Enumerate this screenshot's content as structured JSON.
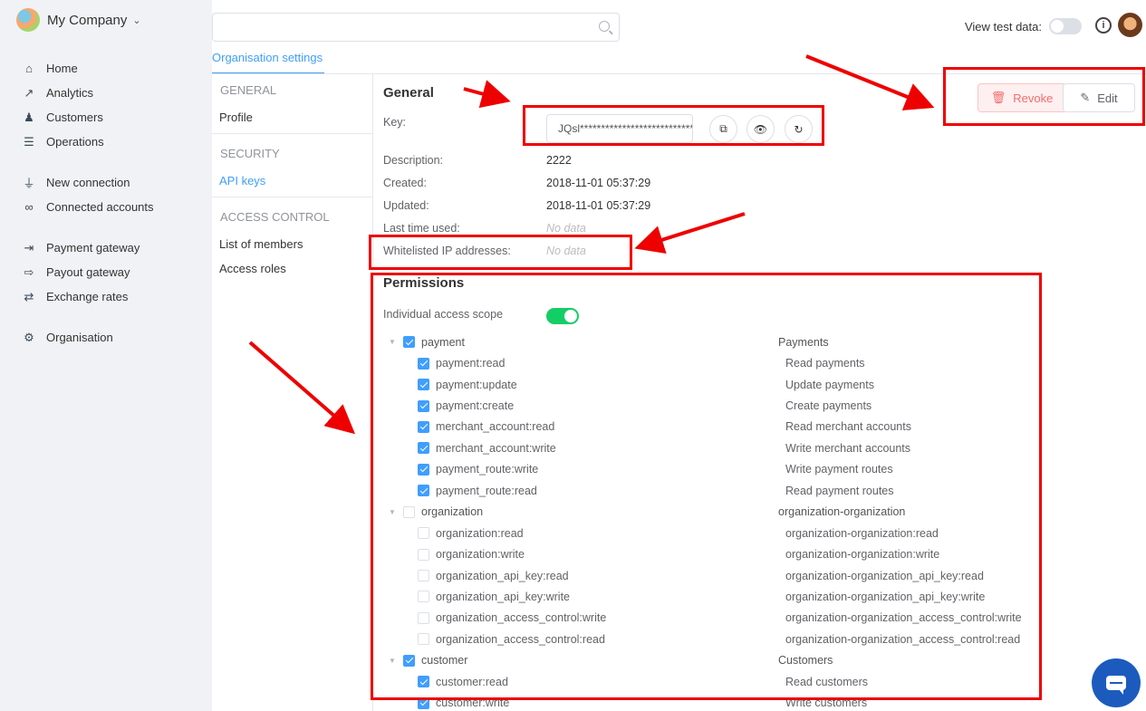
{
  "company": {
    "name": "My Company"
  },
  "nav": {
    "groups": [
      [
        {
          "label": "Home",
          "icon": "home-icon"
        },
        {
          "label": "Analytics",
          "icon": "analytics-icon"
        },
        {
          "label": "Customers",
          "icon": "customers-icon"
        },
        {
          "label": "Operations",
          "icon": "operations-icon"
        }
      ],
      [
        {
          "label": "New connection",
          "icon": "plug-icon"
        },
        {
          "label": "Connected accounts",
          "icon": "link-icon"
        }
      ],
      [
        {
          "label": "Payment gateway",
          "icon": "payment-gateway-icon"
        },
        {
          "label": "Payout gateway",
          "icon": "payout-gateway-icon"
        },
        {
          "label": "Exchange rates",
          "icon": "exchange-icon"
        }
      ],
      [
        {
          "label": "Organisation",
          "icon": "gear-icon"
        }
      ]
    ]
  },
  "topbar": {
    "search_placeholder": "",
    "test_data_label": "View test data:"
  },
  "tabs": {
    "active": "Organisation settings"
  },
  "subnav": {
    "general": "GENERAL",
    "profile": "Profile",
    "security": "SECURITY",
    "api_keys": "API keys",
    "access_control": "ACCESS CONTROL",
    "members": "List of members",
    "roles": "Access roles"
  },
  "general": {
    "title": "General",
    "key_label": "Key:",
    "key_value": "JQsl******************************",
    "description_label": "Description:",
    "description": "2222",
    "created_label": "Created:",
    "created": "2018-11-01 05:37:29",
    "updated_label": "Updated:",
    "updated": "2018-11-01 05:37:29",
    "last_used_label": "Last time used:",
    "last_used": "No data",
    "whitelist_label": "Whitelisted IP addresses:",
    "whitelist": "No data"
  },
  "actions": {
    "revoke": "Revoke",
    "edit": "Edit"
  },
  "permissions": {
    "title": "Permissions",
    "scope_label": "Individual access scope",
    "rows": [
      {
        "kind": "parent",
        "checked": true,
        "name": "payment",
        "desc": "Payments"
      },
      {
        "kind": "child",
        "checked": true,
        "name": "payment:read",
        "desc": "Read payments"
      },
      {
        "kind": "child",
        "checked": true,
        "name": "payment:update",
        "desc": "Update payments"
      },
      {
        "kind": "child",
        "checked": true,
        "name": "payment:create",
        "desc": "Create payments"
      },
      {
        "kind": "child",
        "checked": true,
        "name": "merchant_account:read",
        "desc": "Read merchant accounts"
      },
      {
        "kind": "child",
        "checked": true,
        "name": "merchant_account:write",
        "desc": "Write merchant accounts"
      },
      {
        "kind": "child",
        "checked": true,
        "name": "payment_route:write",
        "desc": "Write payment routes"
      },
      {
        "kind": "child",
        "checked": true,
        "name": "payment_route:read",
        "desc": "Read payment routes"
      },
      {
        "kind": "parent",
        "checked": false,
        "name": "organization",
        "desc": "organization-organization"
      },
      {
        "kind": "child",
        "checked": false,
        "name": "organization:read",
        "desc": "organization-organization:read"
      },
      {
        "kind": "child",
        "checked": false,
        "name": "organization:write",
        "desc": "organization-organization:write"
      },
      {
        "kind": "child",
        "checked": false,
        "name": "organization_api_key:read",
        "desc": "organization-organization_api_key:read"
      },
      {
        "kind": "child",
        "checked": false,
        "name": "organization_api_key:write",
        "desc": "organization-organization_api_key:write"
      },
      {
        "kind": "child",
        "checked": false,
        "name": "organization_access_control:write",
        "desc": "organization-organization_access_control:write"
      },
      {
        "kind": "child",
        "checked": false,
        "name": "organization_access_control:read",
        "desc": "organization-organization_access_control:read"
      },
      {
        "kind": "parent",
        "checked": true,
        "name": "customer",
        "desc": "Customers"
      },
      {
        "kind": "child",
        "checked": true,
        "name": "customer:read",
        "desc": "Read customers"
      },
      {
        "kind": "child",
        "checked": true,
        "name": "customer:write",
        "desc": "Write customers"
      }
    ]
  },
  "colors": {
    "accent": "#409eff",
    "annotation": "#e00000",
    "toggle_on": "#13ce66",
    "danger": "#f56c6c"
  }
}
